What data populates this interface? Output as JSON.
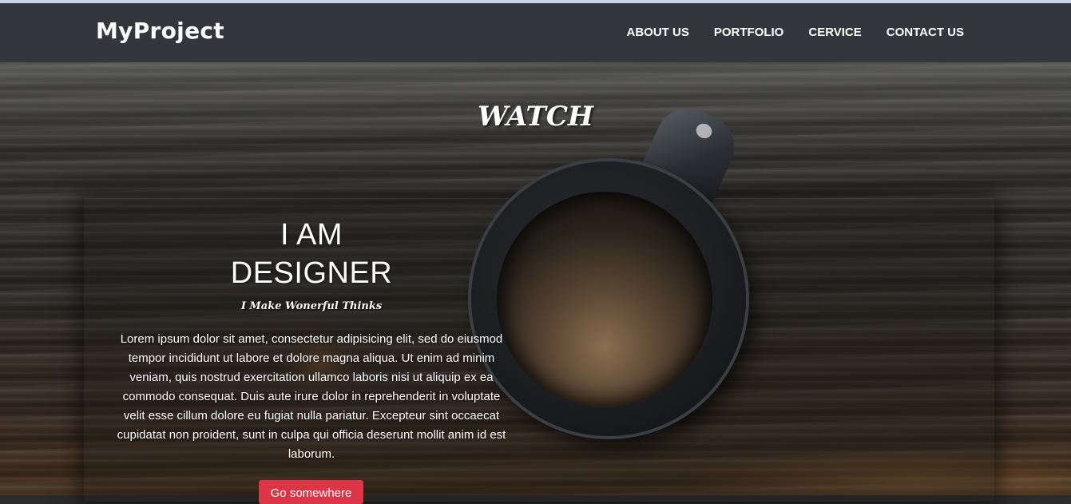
{
  "header": {
    "brand": "MyProject",
    "nav": [
      {
        "label": "ABOUT US"
      },
      {
        "label": "PORTFOLIO"
      },
      {
        "label": "CERVICE"
      },
      {
        "label": "CONTACT US"
      }
    ]
  },
  "hero": {
    "title": "WATCH",
    "headline_line1": "I AM",
    "headline_line2": "DESIGNER",
    "tagline": "I Make Wonerful Thinks",
    "body": "Lorem ipsum dolor sit amet, consectetur adipisicing elit, sed do eiusmod tempor incididunt ut labore et dolore magna aliqua. Ut enim ad minim veniam, quis nostrud exercitation ullamco laboris nisi ut aliquip ex ea commodo consequat. Duis aute irure dolor in reprehenderit in voluptate velit esse cillum dolore eu fugiat nulla pariatur. Excepteur sint occaecat cupidatat non proident, sunt in culpa qui officia deserunt mollit anim id est laborum.",
    "cta_label": "Go somewhere"
  },
  "colors": {
    "navbar": "#33363c",
    "cta": "#dc3545"
  }
}
